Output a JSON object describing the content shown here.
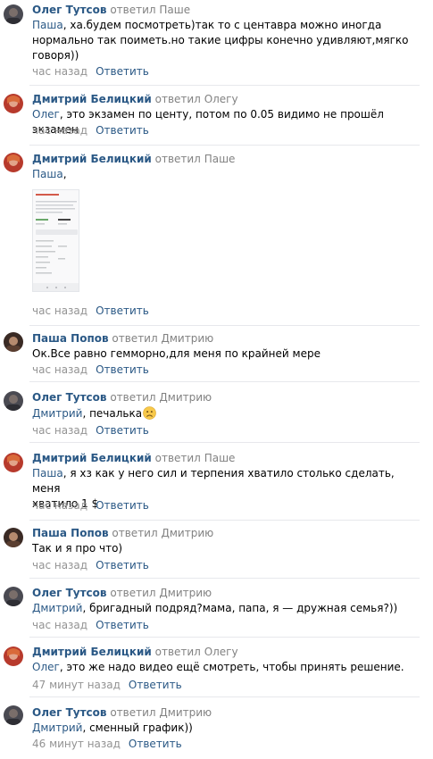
{
  "comments": [
    {
      "author": "Олег Тутсов",
      "replied": "ответил",
      "target": "Паше",
      "mention": "Паша",
      "text_line1": ", ха.будем посмотреть)так то с центавра можно иногда",
      "text_line2": "нормально так поиметь.но такие цифры конечно удивляют,мягко",
      "text_line3": "говоря))",
      "time": "час назад",
      "reply": "Ответить"
    },
    {
      "author": "Дмитрий Белицкий",
      "replied": "ответил",
      "target": "Олегу",
      "mention": "Олег",
      "text_line1": ", это экзамен по центу, потом по 0.05 видимо не прошёл экзамен",
      "time": "час назад",
      "reply": "Ответить"
    },
    {
      "author": "Дмитрий Белицкий",
      "replied": "ответил",
      "target": "Паше",
      "mention": "Паша",
      "text_line1": ",",
      "time": "час назад",
      "reply": "Ответить"
    },
    {
      "author": "Паша Попов",
      "replied": "ответил",
      "target": "Дмитрию",
      "text_line1": "Ок.Все равно гемморно,для меня по крайней мере",
      "time": "час назад",
      "reply": "Ответить"
    },
    {
      "author": "Олег Тутсов",
      "replied": "ответил",
      "target": "Дмитрию",
      "mention": "Дмитрий",
      "text_line1": ", печалька",
      "time": "час назад",
      "reply": "Ответить"
    },
    {
      "author": "Дмитрий Белицкий",
      "replied": "ответил",
      "target": "Паше",
      "mention": "Паша",
      "text_line1": ", я хз как у него сил и терпения хватило столько сделать, меня",
      "text_line2": "хватило 1 $",
      "time": "час назад",
      "reply": "Ответить"
    },
    {
      "author": "Паша Попов",
      "replied": "ответил",
      "target": "Дмитрию",
      "text_line1": "Так и я про что)",
      "time": "час назад",
      "reply": "Ответить"
    },
    {
      "author": "Олег Тутсов",
      "replied": "ответил",
      "target": "Дмитрию",
      "mention": "Дмитрий",
      "text_line1": ", бригадный подряд?мама, папа, я — дружная семья?))",
      "time": "час назад",
      "reply": "Ответить"
    },
    {
      "author": "Дмитрий Белицкий",
      "replied": "ответил",
      "target": "Олегу",
      "mention": "Олег",
      "text_line1": ", это же надо видео ещё смотреть, чтобы принять решение.",
      "time": "47 минут назад",
      "reply": "Ответить"
    },
    {
      "author": "Олег Тутсов",
      "replied": "ответил",
      "target": "Дмитрию",
      "mention": "Дмитрий",
      "text_line1": ", сменный график))",
      "time": "46 минут назад",
      "reply": "Ответить"
    }
  ],
  "colors": {
    "link": "#2a5885",
    "meta": "#939393",
    "divider": "#e7e8ec"
  }
}
